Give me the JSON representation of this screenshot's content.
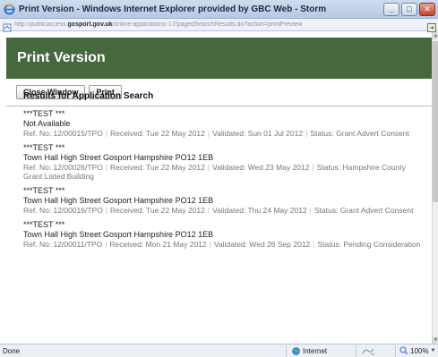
{
  "window": {
    "title": "Print Version - Windows Internet Explorer provided by GBC Web - Storm",
    "minimize_glyph": "_",
    "maximize_glyph": "□",
    "close_glyph": "✕"
  },
  "address": {
    "prefix": "http://publicaccess.",
    "domain": "gosport.gov.uk",
    "suffix": "/online-applications-17/pagedSearchResults.do?action=printPreview"
  },
  "page": {
    "title": "Print Version",
    "close_window_label": "Close Window",
    "print_label": "Print",
    "results_heading": "Results for Application Search"
  },
  "results": [
    {
      "title": "***TEST ***",
      "address": "Not Available",
      "ref": "Ref. No: 12/00015/TPO",
      "received": "Received: Tue 22 May 2012",
      "validated": "Validated: Sun 01 Jul 2012",
      "status": "Status: Grant Advert Consent"
    },
    {
      "title": "***TEST ***",
      "address": "Town Hall High Street Gosport Hampshire PO12 1EB",
      "ref": "Ref. No: 12/00026/TPO",
      "received": "Received: Tue 22 May 2012",
      "validated": "Validated: Wed 23 May 2012",
      "status": "Status: Hampshire County Grant Listed Building"
    },
    {
      "title": "***TEST ***",
      "address": "Town Hall High Street Gosport Hampshire PO12 1EB",
      "ref": "Ref. No: 12/00016/TPO",
      "received": "Received: Tue 22 May 2012",
      "validated": "Validated: Thu 24 May 2012",
      "status": "Status: Grant Advert Consent"
    },
    {
      "title": "***TEST ***",
      "address": "Town Hall High Street Gosport Hampshire PO12 1EB",
      "ref": "Ref. No: 12/00011/TPO",
      "received": "Received: Mon 21 May 2012",
      "validated": "Validated: Wed 26 Sep 2012",
      "status": "Status: Pending Consideration"
    }
  ],
  "status": {
    "left": "Done",
    "zone": "Internet",
    "zoom": "100%"
  },
  "colors": {
    "banner": "#46683e",
    "title_bar": "#b8c9e4"
  },
  "icons": {
    "window": "ie-icon",
    "page": "page-icon",
    "zone": "globe-icon",
    "zoom": "zoom-icon"
  }
}
